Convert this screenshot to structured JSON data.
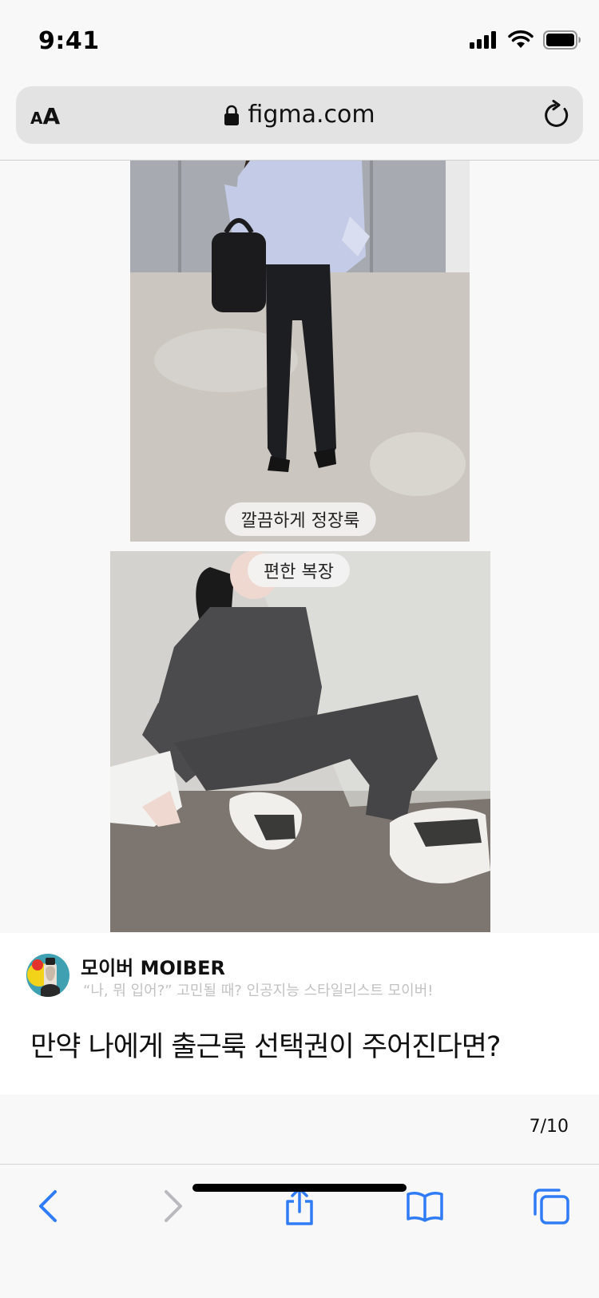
{
  "status_bar": {
    "time": "9:41",
    "icons": [
      "cellular-signal-icon",
      "wifi-icon",
      "battery-icon"
    ]
  },
  "browser": {
    "text_size_small": "A",
    "text_size_big": "A",
    "domain": "figma.com",
    "icons": [
      "lock-icon",
      "reload-icon"
    ]
  },
  "photos": [
    {
      "caption": "깔끔하게 정장룩"
    },
    {
      "caption": "편한 복장"
    }
  ],
  "post": {
    "author": "모이버 MOIBER",
    "tagline": "“나, 뭐 입어?” 고민될 때? 인공지능 스타일리스트 모이버!",
    "title": "만약 나에게 출근룩 선택권이 주어진다면?"
  },
  "pagination": "7/10",
  "toolbar": {
    "icons": [
      "back-chevron-icon",
      "forward-chevron-icon",
      "share-icon",
      "bookmarks-icon",
      "tabs-icon"
    ]
  },
  "colors": {
    "accent": "#2f7cf6",
    "disabled": "#b9b9bf",
    "background": "#f8f8f8"
  }
}
